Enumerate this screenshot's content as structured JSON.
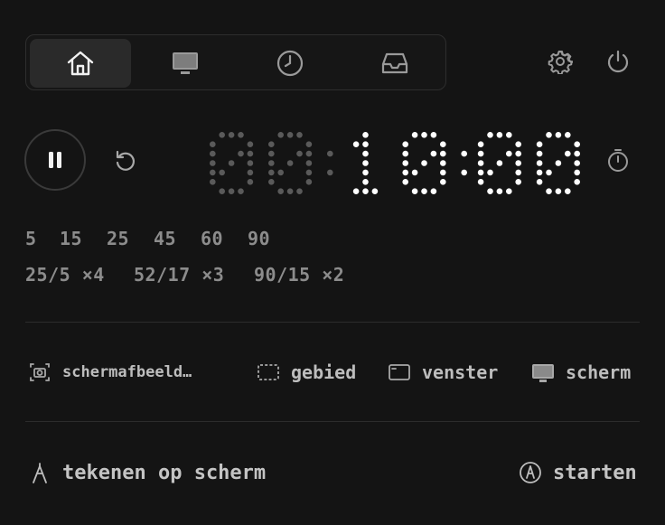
{
  "nav": {
    "tabs": [
      {
        "name": "home-icon",
        "active": true
      },
      {
        "name": "monitor-icon",
        "active": false
      },
      {
        "name": "clock-icon",
        "active": false
      },
      {
        "name": "inbox-icon",
        "active": false
      }
    ],
    "settings_icon": "gear-icon",
    "power_icon": "power-icon"
  },
  "timer": {
    "display": "00:10:00",
    "dim_digits": 2,
    "state": "running",
    "pause_icon": "pause-icon",
    "reset_icon": "rotate-ccw-icon",
    "stopwatch_icon": "stopwatch-icon"
  },
  "presets": {
    "minutes": [
      "5",
      "15",
      "25",
      "45",
      "60",
      "90"
    ],
    "cycles": [
      "25/5 ×4",
      "52/17 ×3",
      "90/15 ×2"
    ]
  },
  "capture": {
    "screenshot_label": "schermafbeeld…",
    "area_label": "gebied",
    "window_label": "venster",
    "screen_label": "scherm"
  },
  "draw": {
    "label": "tekenen op scherm",
    "start_label": "starten"
  },
  "colors": {
    "background": "#141414",
    "lit_dot": "#ffffff",
    "dim_dot": "#5a5a5a",
    "text_muted": "#8c8c8c"
  }
}
